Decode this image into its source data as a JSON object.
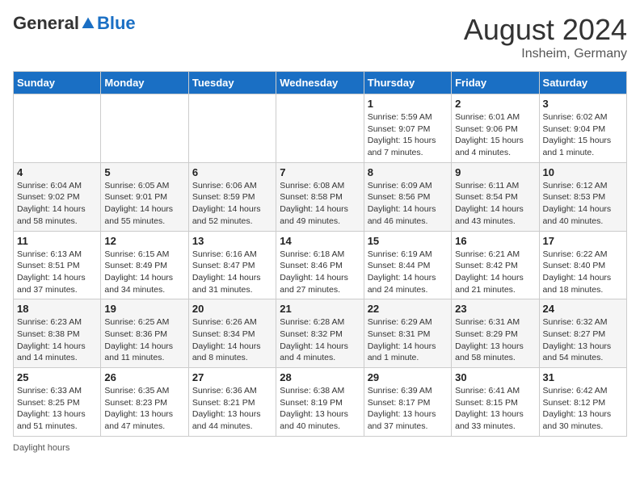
{
  "header": {
    "logo_general": "General",
    "logo_blue": "Blue",
    "month_title": "August 2024",
    "subtitle": "Insheim, Germany"
  },
  "days_of_week": [
    "Sunday",
    "Monday",
    "Tuesday",
    "Wednesday",
    "Thursday",
    "Friday",
    "Saturday"
  ],
  "weeks": [
    [
      {
        "day": "",
        "info": ""
      },
      {
        "day": "",
        "info": ""
      },
      {
        "day": "",
        "info": ""
      },
      {
        "day": "",
        "info": ""
      },
      {
        "day": "1",
        "info": "Sunrise: 5:59 AM\nSunset: 9:07 PM\nDaylight: 15 hours and 7 minutes."
      },
      {
        "day": "2",
        "info": "Sunrise: 6:01 AM\nSunset: 9:06 PM\nDaylight: 15 hours and 4 minutes."
      },
      {
        "day": "3",
        "info": "Sunrise: 6:02 AM\nSunset: 9:04 PM\nDaylight: 15 hours and 1 minute."
      }
    ],
    [
      {
        "day": "4",
        "info": "Sunrise: 6:04 AM\nSunset: 9:02 PM\nDaylight: 14 hours and 58 minutes."
      },
      {
        "day": "5",
        "info": "Sunrise: 6:05 AM\nSunset: 9:01 PM\nDaylight: 14 hours and 55 minutes."
      },
      {
        "day": "6",
        "info": "Sunrise: 6:06 AM\nSunset: 8:59 PM\nDaylight: 14 hours and 52 minutes."
      },
      {
        "day": "7",
        "info": "Sunrise: 6:08 AM\nSunset: 8:58 PM\nDaylight: 14 hours and 49 minutes."
      },
      {
        "day": "8",
        "info": "Sunrise: 6:09 AM\nSunset: 8:56 PM\nDaylight: 14 hours and 46 minutes."
      },
      {
        "day": "9",
        "info": "Sunrise: 6:11 AM\nSunset: 8:54 PM\nDaylight: 14 hours and 43 minutes."
      },
      {
        "day": "10",
        "info": "Sunrise: 6:12 AM\nSunset: 8:53 PM\nDaylight: 14 hours and 40 minutes."
      }
    ],
    [
      {
        "day": "11",
        "info": "Sunrise: 6:13 AM\nSunset: 8:51 PM\nDaylight: 14 hours and 37 minutes."
      },
      {
        "day": "12",
        "info": "Sunrise: 6:15 AM\nSunset: 8:49 PM\nDaylight: 14 hours and 34 minutes."
      },
      {
        "day": "13",
        "info": "Sunrise: 6:16 AM\nSunset: 8:47 PM\nDaylight: 14 hours and 31 minutes."
      },
      {
        "day": "14",
        "info": "Sunrise: 6:18 AM\nSunset: 8:46 PM\nDaylight: 14 hours and 27 minutes."
      },
      {
        "day": "15",
        "info": "Sunrise: 6:19 AM\nSunset: 8:44 PM\nDaylight: 14 hours and 24 minutes."
      },
      {
        "day": "16",
        "info": "Sunrise: 6:21 AM\nSunset: 8:42 PM\nDaylight: 14 hours and 21 minutes."
      },
      {
        "day": "17",
        "info": "Sunrise: 6:22 AM\nSunset: 8:40 PM\nDaylight: 14 hours and 18 minutes."
      }
    ],
    [
      {
        "day": "18",
        "info": "Sunrise: 6:23 AM\nSunset: 8:38 PM\nDaylight: 14 hours and 14 minutes."
      },
      {
        "day": "19",
        "info": "Sunrise: 6:25 AM\nSunset: 8:36 PM\nDaylight: 14 hours and 11 minutes."
      },
      {
        "day": "20",
        "info": "Sunrise: 6:26 AM\nSunset: 8:34 PM\nDaylight: 14 hours and 8 minutes."
      },
      {
        "day": "21",
        "info": "Sunrise: 6:28 AM\nSunset: 8:32 PM\nDaylight: 14 hours and 4 minutes."
      },
      {
        "day": "22",
        "info": "Sunrise: 6:29 AM\nSunset: 8:31 PM\nDaylight: 14 hours and 1 minute."
      },
      {
        "day": "23",
        "info": "Sunrise: 6:31 AM\nSunset: 8:29 PM\nDaylight: 13 hours and 58 minutes."
      },
      {
        "day": "24",
        "info": "Sunrise: 6:32 AM\nSunset: 8:27 PM\nDaylight: 13 hours and 54 minutes."
      }
    ],
    [
      {
        "day": "25",
        "info": "Sunrise: 6:33 AM\nSunset: 8:25 PM\nDaylight: 13 hours and 51 minutes."
      },
      {
        "day": "26",
        "info": "Sunrise: 6:35 AM\nSunset: 8:23 PM\nDaylight: 13 hours and 47 minutes."
      },
      {
        "day": "27",
        "info": "Sunrise: 6:36 AM\nSunset: 8:21 PM\nDaylight: 13 hours and 44 minutes."
      },
      {
        "day": "28",
        "info": "Sunrise: 6:38 AM\nSunset: 8:19 PM\nDaylight: 13 hours and 40 minutes."
      },
      {
        "day": "29",
        "info": "Sunrise: 6:39 AM\nSunset: 8:17 PM\nDaylight: 13 hours and 37 minutes."
      },
      {
        "day": "30",
        "info": "Sunrise: 6:41 AM\nSunset: 8:15 PM\nDaylight: 13 hours and 33 minutes."
      },
      {
        "day": "31",
        "info": "Sunrise: 6:42 AM\nSunset: 8:12 PM\nDaylight: 13 hours and 30 minutes."
      }
    ]
  ],
  "footer": {
    "daylight_label": "Daylight hours"
  }
}
